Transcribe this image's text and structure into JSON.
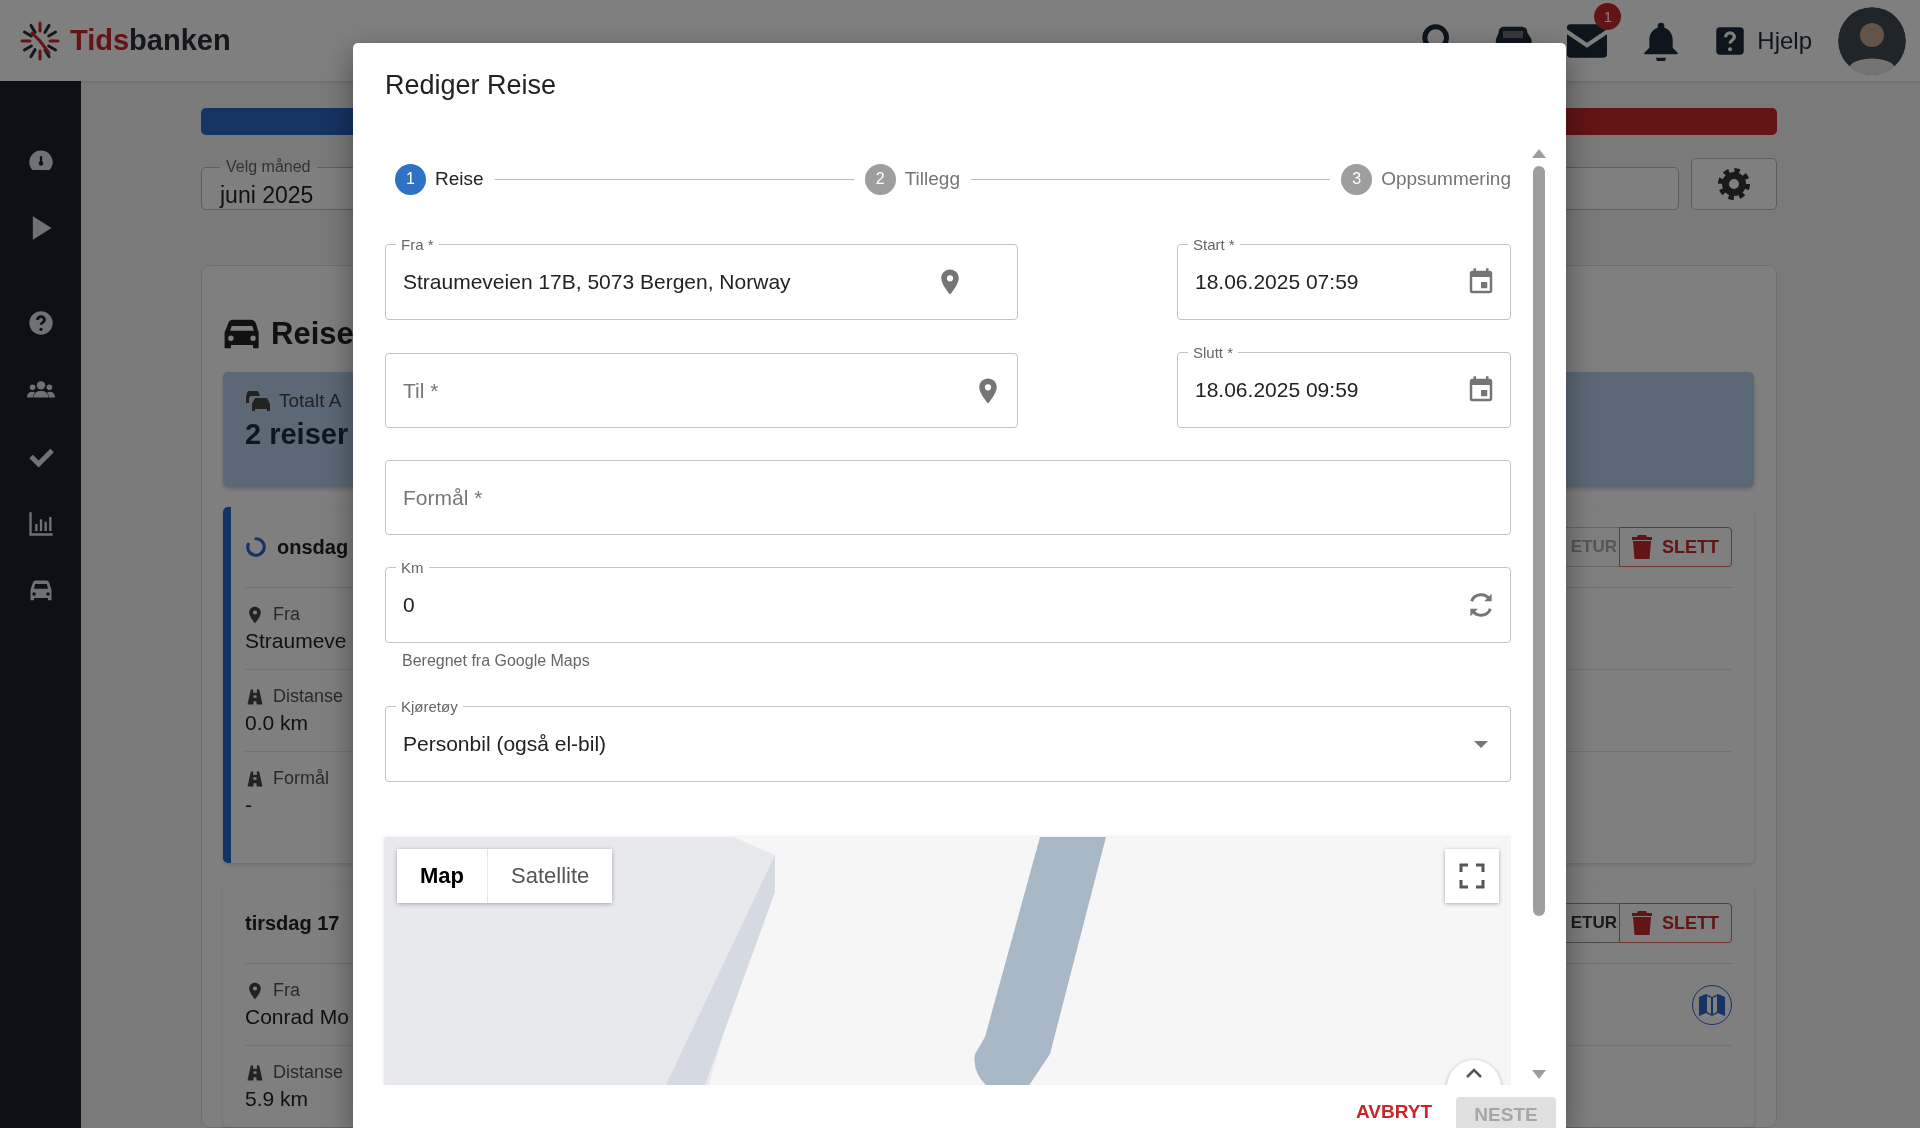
{
  "header": {
    "logo_prefix": "Tids",
    "logo_suffix": "banken",
    "mail_badge": "1",
    "help_label": "Hjelp"
  },
  "page": {
    "month_field": {
      "label": "Velg måned",
      "value": "juni 2025"
    },
    "section_title": "Reise",
    "summary": {
      "label": "Totalt A",
      "value": "2 reiser"
    },
    "trips": [
      {
        "date": "onsdag",
        "highlighted": true,
        "retur_label": "ETUR",
        "retur_disabled": true,
        "delete_label": "SLETT",
        "has_map": false,
        "rows": [
          {
            "kind": "place",
            "label": "Fra",
            "value": "Straumeve"
          },
          {
            "kind": "road",
            "label": "Distanse",
            "value": "0.0 km"
          },
          {
            "kind": "road",
            "label": "Formål",
            "value": "-"
          }
        ]
      },
      {
        "date": "tirsdag 17",
        "highlighted": false,
        "retur_label": "ETUR",
        "retur_disabled": false,
        "delete_label": "SLETT",
        "has_map": true,
        "rows": [
          {
            "kind": "place",
            "label": "Fra",
            "value": "Conrad Mo"
          },
          {
            "kind": "road",
            "label": "Distanse",
            "value": "5.9 km"
          }
        ]
      }
    ]
  },
  "dialog": {
    "title": "Rediger Reise",
    "steps": [
      {
        "number": "1",
        "label": "Reise",
        "selected": true
      },
      {
        "number": "2",
        "label": "Tillegg",
        "selected": false
      },
      {
        "number": "3",
        "label": "Oppsummering",
        "selected": false
      }
    ],
    "from": {
      "label": "Fra *",
      "value": "Straumeveien 17B, 5073 Bergen, Norway"
    },
    "start": {
      "label": "Start *",
      "value": "18.06.2025 07:59"
    },
    "to": {
      "placeholder": "Til *"
    },
    "end": {
      "label": "Slutt *",
      "value": "18.06.2025 09:59"
    },
    "purpose": {
      "placeholder": "Formål *"
    },
    "km": {
      "label": "Km",
      "value": "0",
      "helper": "Beregnet fra Google Maps"
    },
    "vehicle": {
      "label": "Kjøretøy",
      "value": "Personbil (også el-bil)"
    },
    "map": {
      "map_types": [
        {
          "label": "Map",
          "selected": true
        },
        {
          "label": "Satellite",
          "selected": false
        }
      ]
    },
    "footer": {
      "cancel": "AVBRYT",
      "next": "NESTE",
      "next_disabled": true
    }
  }
}
